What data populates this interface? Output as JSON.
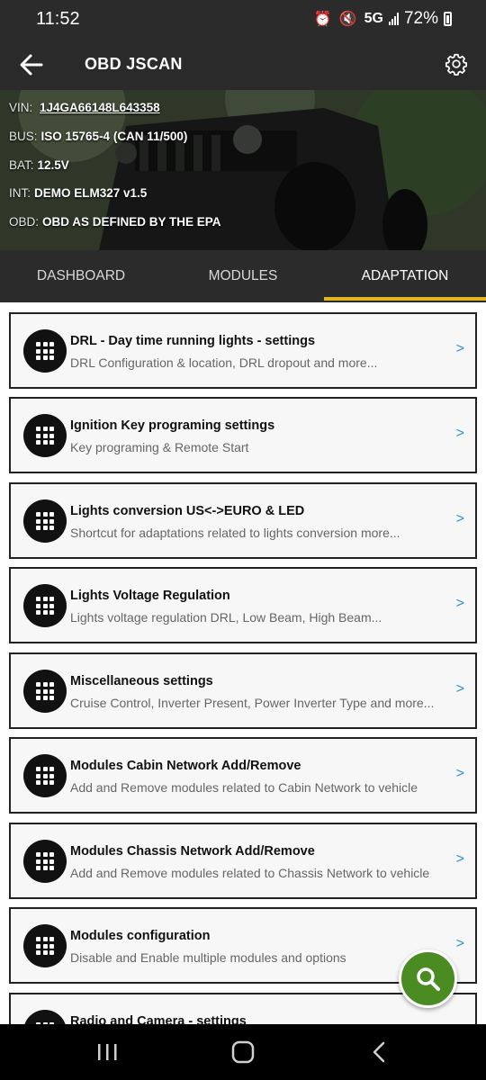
{
  "status_bar": {
    "time": "11:52",
    "network": "5G",
    "battery": "72%"
  },
  "app_bar": {
    "title": "OBD JSCAN",
    "back_icon": "arrow-left-icon",
    "settings_icon": "gear-icon"
  },
  "vehicle_info": [
    {
      "label": "VIN:",
      "value": "1J4GA66148L643358"
    },
    {
      "label": "BUS:",
      "value": "ISO 15765-4 (CAN 11/500)"
    },
    {
      "label": "BAT:",
      "value": "12.5V"
    },
    {
      "label": "INT:",
      "value": "DEMO ELM327 v1.5"
    },
    {
      "label": "OBD:",
      "value": "OBD AS DEFINED BY THE EPA"
    }
  ],
  "tabs": [
    {
      "label": "DASHBOARD",
      "active": false
    },
    {
      "label": "MODULES",
      "active": false
    },
    {
      "label": "ADAPTATION",
      "active": true
    }
  ],
  "adaptations": [
    {
      "title": "DRL - Day time running lights - settings",
      "subtitle": "DRL Configuration & location, DRL dropout and more...",
      "chevron": ">"
    },
    {
      "title": "Ignition Key programing settings",
      "subtitle": "Key programing & Remote Start",
      "chevron": ">"
    },
    {
      "title": "Lights conversion US<->EURO & LED",
      "subtitle": "Shortcut for adaptations related to lights conversion more...",
      "chevron": ">"
    },
    {
      "title": "Lights Voltage Regulation",
      "subtitle": "Lights voltage regulation DRL, Low Beam, High Beam...",
      "chevron": ">"
    },
    {
      "title": "Miscellaneous settings",
      "subtitle": "Cruise Control, Inverter Present, Power Inverter Type and more...",
      "chevron": ">"
    },
    {
      "title": "Modules Cabin Network Add/Remove",
      "subtitle": "Add and Remove modules related to Cabin Network to vehicle",
      "chevron": ">"
    },
    {
      "title": "Modules Chassis Network Add/Remove",
      "subtitle": "Add and Remove modules related to Chassis Network to vehicle",
      "chevron": ">"
    },
    {
      "title": "Modules configuration",
      "subtitle": "Disable and Enable multiple modules and options",
      "chevron": ">"
    },
    {
      "title": "Radio and Camera - settings",
      "subtitle": "",
      "chevron": ""
    }
  ],
  "fab": {
    "icon": "search-icon"
  },
  "colors": {
    "accent": "#e2b623",
    "fab": "#4b8c22",
    "chevron": "#2a8fd6",
    "app_bar": "#2a2a2a"
  }
}
